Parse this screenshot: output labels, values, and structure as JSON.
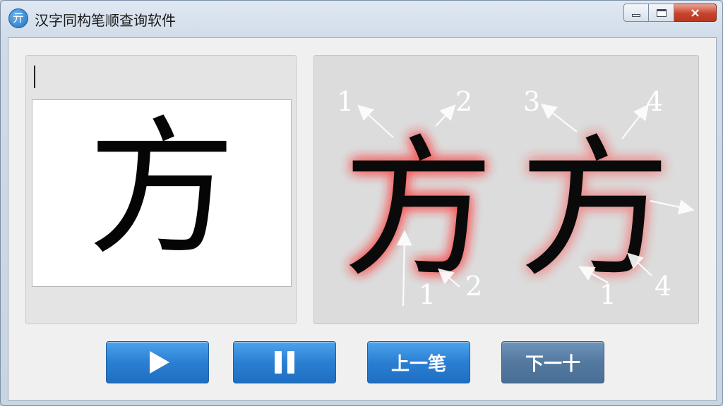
{
  "window": {
    "title": "汉字同构笔顺查询软件",
    "icon_glyph": "亓",
    "controls": {
      "minimize": "minimize-icon",
      "maximize": "maximize-icon",
      "close": "×"
    }
  },
  "input": {
    "value": ""
  },
  "preview": {
    "character": "方"
  },
  "animation": {
    "left_char": "方",
    "right_char": "方",
    "labels_top": [
      "1",
      "2",
      "3",
      "4"
    ],
    "labels_bottom": [
      "1",
      "2",
      "1",
      "4"
    ],
    "highlight_color": "#ff2a2a"
  },
  "buttons": {
    "play": "play-icon",
    "pause": "pause-icon",
    "prev_label": "上一笔",
    "next_label": "下一十"
  },
  "colors": {
    "button_blue": "#2b7fd3",
    "button_muted": "#53799f",
    "close_red": "#c9432c"
  }
}
